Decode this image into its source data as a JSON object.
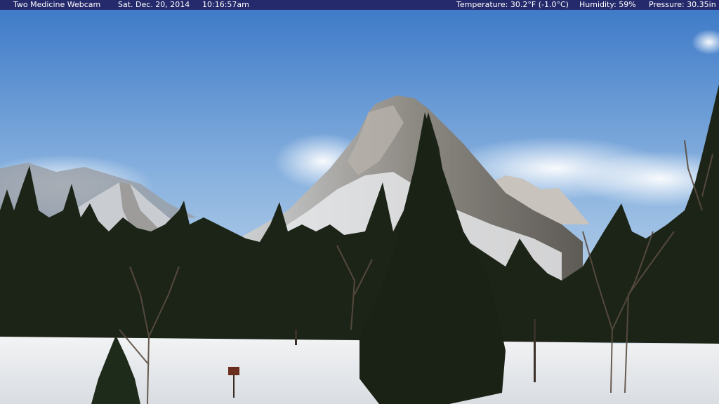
{
  "overlay": {
    "title": "Two Medicine Webcam",
    "date": "Sat. Dec. 20, 2014",
    "time": "10:16:57am",
    "temperature": "Temperature: 30.2°F (-1.0°C)",
    "humidity": "Humidity: 59%",
    "pressure": "Pressure: 30.35in"
  },
  "colors": {
    "bar": "#242a6b",
    "sky_top": "#4a84cf",
    "sky_bottom": "#d8e6f0",
    "snow": "#eef0f2",
    "trees": "#1b2218"
  }
}
